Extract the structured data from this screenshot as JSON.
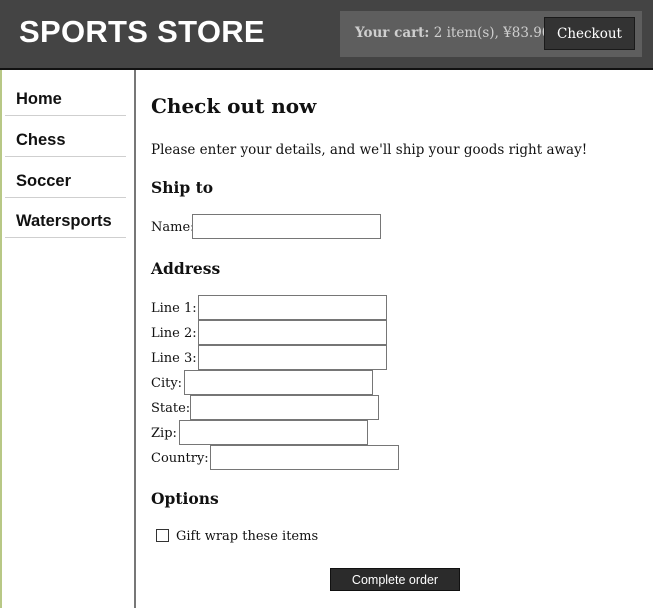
{
  "header": {
    "brand": "SPORTS STORE",
    "cart_label": "Your cart:",
    "cart_summary": "2 item(s), ¥83.90",
    "checkout_label": "Checkout"
  },
  "sidebar": {
    "items": [
      {
        "label": "Home"
      },
      {
        "label": "Chess"
      },
      {
        "label": "Soccer"
      },
      {
        "label": "Watersports"
      }
    ]
  },
  "main": {
    "title": "Check out now",
    "intro": "Please enter your details, and we'll ship your goods right away!",
    "ship_to": {
      "heading": "Ship to",
      "name_label": "Name:",
      "name_value": ""
    },
    "address": {
      "heading": "Address",
      "fields": [
        {
          "label": "Line 1:",
          "value": ""
        },
        {
          "label": "Line 2:",
          "value": ""
        },
        {
          "label": "Line 3:",
          "value": ""
        },
        {
          "label": "City:",
          "value": ""
        },
        {
          "label": "State:",
          "value": ""
        },
        {
          "label": "Zip:",
          "value": ""
        },
        {
          "label": "Country:",
          "value": ""
        }
      ]
    },
    "options": {
      "heading": "Options",
      "gift_wrap_label": "Gift wrap these items",
      "gift_wrap_checked": false
    },
    "complete_label": "Complete order"
  },
  "colors": {
    "header_bg": "#444444",
    "cart_box_bg": "#5e5e5e",
    "button_bg": "#333333",
    "sidebar_left_accent": "#b8c886"
  }
}
